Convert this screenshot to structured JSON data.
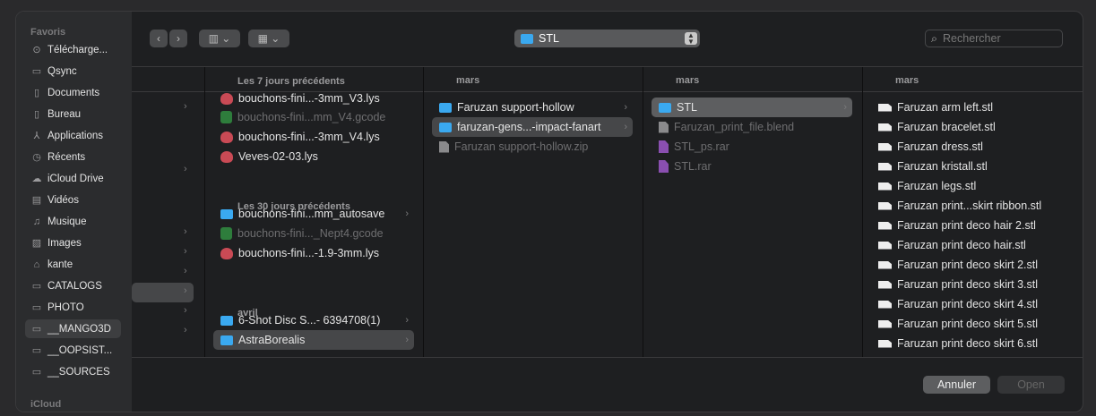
{
  "sidebar": {
    "favorites_header": "Favoris",
    "icloud_header": "iCloud",
    "items": [
      {
        "label": "Télécharge...",
        "icon": "download-icon"
      },
      {
        "label": "Qsync",
        "icon": "folder-icon"
      },
      {
        "label": "Documents",
        "icon": "document-icon"
      },
      {
        "label": "Bureau",
        "icon": "document-icon"
      },
      {
        "label": "Applications",
        "icon": "applications-icon"
      },
      {
        "label": "Récents",
        "icon": "clock-icon"
      },
      {
        "label": "iCloud Drive",
        "icon": "cloud-icon"
      },
      {
        "label": "Vidéos",
        "icon": "film-icon"
      },
      {
        "label": "Musique",
        "icon": "music-icon"
      },
      {
        "label": "Images",
        "icon": "image-icon"
      },
      {
        "label": "kante",
        "icon": "home-icon"
      },
      {
        "label": "CATALOGS",
        "icon": "folder-icon"
      },
      {
        "label": "PHOTO",
        "icon": "folder-icon"
      },
      {
        "label": "__MANGO3D",
        "icon": "folder-icon",
        "selected": true
      },
      {
        "label": "__OOPSIST...",
        "icon": "folder-icon"
      },
      {
        "label": "__SOURCES",
        "icon": "folder-icon"
      }
    ]
  },
  "toolbar": {
    "path": "STL",
    "search_placeholder": "Rechercher"
  },
  "columns": {
    "col1": {
      "groups": [
        {
          "header": "Les 7 jours précédents",
          "items": [
            {
              "name": "bouchons-fini...-3mm_V3.lys",
              "type": "lys"
            },
            {
              "name": "bouchons-fini...mm_V4.gcode",
              "type": "gcode",
              "dim": true
            },
            {
              "name": "bouchons-fini...-3mm_V4.lys",
              "type": "lys"
            },
            {
              "name": "Veves-02-03.lys",
              "type": "lys"
            }
          ]
        },
        {
          "header": "Les 30 jours précédents",
          "items": [
            {
              "name": "bouchons-fini...mm_autosave",
              "type": "folder"
            },
            {
              "name": "bouchons-fini..._Nept4.gcode",
              "type": "gcode",
              "dim": true
            },
            {
              "name": "bouchons-fini...-1.9-3mm.lys",
              "type": "lys"
            }
          ]
        },
        {
          "header": "avril",
          "items": [
            {
              "name": "6-Shot Disc S...- 6394708(1)",
              "type": "folder"
            },
            {
              "name": "AstraBorealis",
              "type": "folder",
              "selected": true
            }
          ]
        }
      ]
    },
    "col2": {
      "header": "mars",
      "items": [
        {
          "name": "Faruzan support-hollow",
          "type": "folder"
        },
        {
          "name": "faruzan-gens...-impact-fanart",
          "type": "folder",
          "selected": true
        },
        {
          "name": "Faruzan support-hollow.zip",
          "type": "zip",
          "dim": true
        }
      ]
    },
    "col3": {
      "header": "mars",
      "items": [
        {
          "name": "STL",
          "type": "folder",
          "selected": true
        },
        {
          "name": "Faruzan_print_file.blend",
          "type": "blend",
          "dim": true
        },
        {
          "name": "STL_ps.rar",
          "type": "rar",
          "dim": true
        },
        {
          "name": "STL.rar",
          "type": "rar",
          "dim": true
        }
      ]
    },
    "col4": {
      "header": "mars",
      "items": [
        "Faruzan arm left.stl",
        "Faruzan bracelet.stl",
        "Faruzan dress.stl",
        "Faruzan kristall.stl",
        "Faruzan legs.stl",
        "Faruzan print...skirt ribbon.stl",
        "Faruzan print deco hair 2.stl",
        "Faruzan print deco hair.stl",
        "Faruzan print deco skirt 2.stl",
        "Faruzan print deco skirt 3.stl",
        "Faruzan print deco skirt 4.stl",
        "Faruzan print deco skirt 5.stl",
        "Faruzan print deco skirt 6.stl"
      ]
    }
  },
  "footer": {
    "cancel": "Annuler",
    "open": "Open"
  }
}
